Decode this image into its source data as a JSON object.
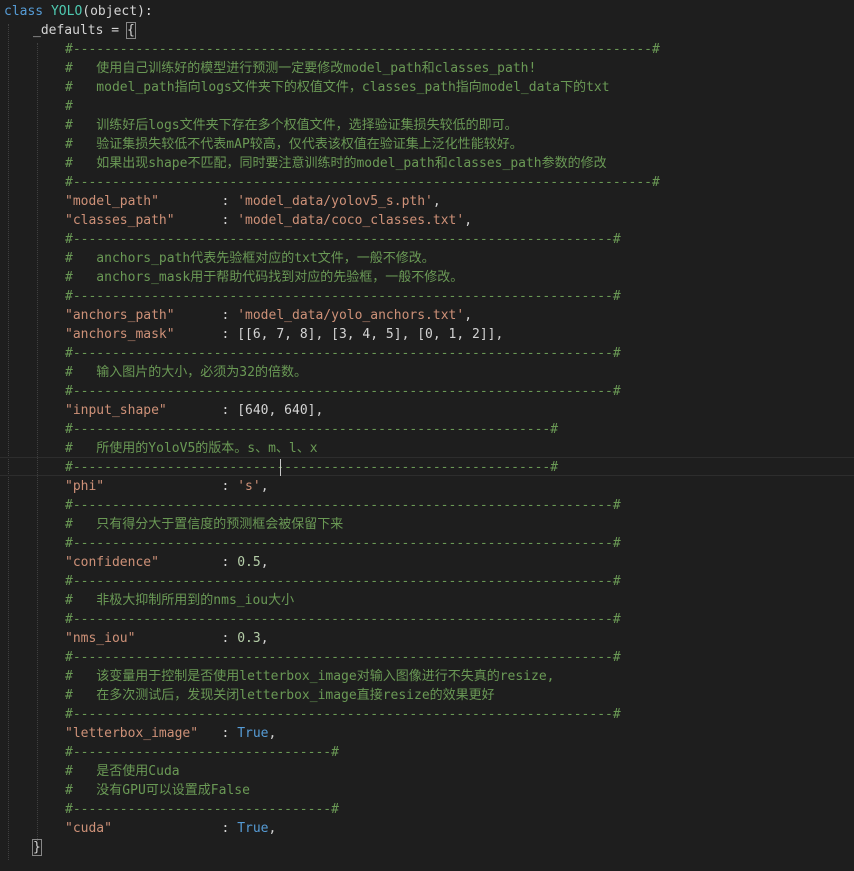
{
  "code": {
    "class_keyword": "class",
    "class_name": "YOLO",
    "class_base": "(object):",
    "defaults_name": "_defaults",
    "defaults_assign": " = ",
    "open_brace": "{",
    "close_brace": "}",
    "sep_long": "#--------------------------------------------------------------------------#",
    "sep_medium": "#---------------------------------------------------------------------#",
    "sep_short": "#-------------------------------------------------------------#",
    "sep_tiny": "#---------------------------------#",
    "hash_empty": "#",
    "comments": {
      "model_1": "#   使用自己训练好的模型进行预测一定要修改model_path和classes_path!",
      "model_2": "#   model_path指向logs文件夹下的权值文件，classes_path指向model_data下的txt",
      "model_3": "#   训练好后logs文件夹下存在多个权值文件，选择验证集损失较低的即可。",
      "model_4": "#   验证集损失较低不代表mAP较高，仅代表该权值在验证集上泛化性能较好。",
      "model_5": "#   如果出现shape不匹配，同时要注意训练时的model_path和classes_path参数的修改",
      "anchors_1": "#   anchors_path代表先验框对应的txt文件，一般不修改。",
      "anchors_2": "#   anchors_mask用于帮助代码找到对应的先验框，一般不修改。",
      "input": "#   输入图片的大小，必须为32的倍数。",
      "phi": "#   所使用的YoloV5的版本。s、m、l、x",
      "confidence": "#   只有得分大于置信度的预测框会被保留下来",
      "nms": "#   非极大抑制所用到的nms_iou大小",
      "letterbox_1": "#   该变量用于控制是否使用letterbox_image对输入图像进行不失真的resize,",
      "letterbox_2": "#   在多次测试后，发现关闭letterbox_image直接resize的效果更好",
      "cuda_1": "#   是否使用Cuda",
      "cuda_2": "#   没有GPU可以设置成False"
    },
    "entries": {
      "model_path": {
        "key": "\"model_path\"",
        "pad": "        : ",
        "value": "'model_data/yolov5_s.pth'",
        "end": ","
      },
      "classes_path": {
        "key": "\"classes_path\"",
        "pad": "      : ",
        "value": "'model_data/coco_classes.txt'",
        "end": ","
      },
      "anchors_path": {
        "key": "\"anchors_path\"",
        "pad": "      : ",
        "value": "'model_data/yolo_anchors.txt'",
        "end": ","
      },
      "anchors_mask": {
        "key": "\"anchors_mask\"",
        "pad": "      : ",
        "value": "[[6, 7, 8], [3, 4, 5], [0, 1, 2]]",
        "end": ","
      },
      "input_shape": {
        "key": "\"input_shape\"",
        "pad": "       : ",
        "value": "[640, 640]",
        "end": ","
      },
      "phi": {
        "key": "\"phi\"",
        "pad": "               : ",
        "value": "'s'",
        "end": ","
      },
      "confidence": {
        "key": "\"confidence\"",
        "pad": "        : ",
        "value": "0.5",
        "end": ","
      },
      "nms_iou": {
        "key": "\"nms_iou\"",
        "pad": "           : ",
        "value": "0.3",
        "end": ","
      },
      "letterbox_image": {
        "key": "\"letterbox_image\"",
        "pad": "   : ",
        "value": "True",
        "end": ","
      },
      "cuda": {
        "key": "\"cuda\"",
        "pad": "              : ",
        "value": "True",
        "end": ","
      }
    }
  },
  "colors": {
    "background": "#1e1e1e",
    "keyword": "#569cd6",
    "class_name": "#4ec9b0",
    "string": "#ce9178",
    "comment": "#6a9955",
    "number": "#b5cea8",
    "text": "#d4d4d4"
  }
}
